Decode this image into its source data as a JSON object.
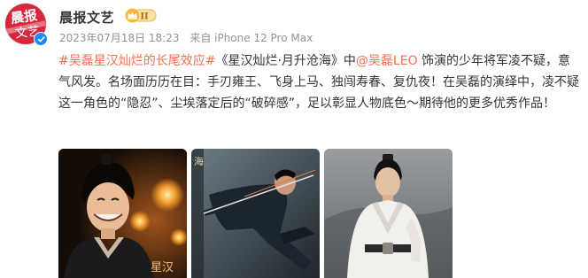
{
  "post": {
    "avatar": {
      "top_text": "晨报",
      "bottom_text": "文艺"
    },
    "author": "晨报文艺",
    "vip_level": "II",
    "timestamp": "2023年07月18日 18:23",
    "source": "来自 iPhone 12 Pro Max",
    "hashtag": "#吴磊星汉灿烂的长尾效应#",
    "text_1": "《星汉灿烂·月升沧海》中",
    "mention": "@吴磊LEO",
    "text_2": " 饰演的少年将军凌不疑，意气风发。名场面历历在目：手刃雍王、飞身上马、独闯寿春、复仇夜！在吴磊的演绎中，凌不疑这一角色的“隐忍”、尘埃落定后的“破碎感”，足以彰显人物底色～期待他的更多优秀作品！"
  },
  "images": [
    {
      "caption": "星汉",
      "icon": "portrait-photo"
    },
    {
      "caption": "海",
      "icon": "action-photo"
    },
    {
      "caption": "",
      "icon": "standing-photo"
    }
  ],
  "colors": {
    "link": "#eb7350",
    "text": "#333333",
    "meta": "#939393",
    "verified": "#1a8bf2",
    "vip_gold": "#f3b83a"
  }
}
